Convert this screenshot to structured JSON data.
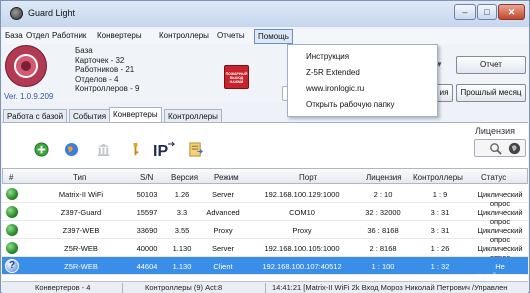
{
  "window": {
    "title": "Guard Light",
    "minimize": "–",
    "maximize": "□",
    "close": "✕"
  },
  "menu": [
    "База",
    "Отдел",
    "Работник",
    "Конвертеры",
    "Контроллеры",
    "Отчеты",
    "Помощь"
  ],
  "info": {
    "db_label": "База",
    "cards": "Карточек - 32",
    "workers": "Работников - 21",
    "departments": "Отделов - 4",
    "controllers": "Контроллеров - 9",
    "version": "Ver. 1.0.9.209",
    "partial_o": "От",
    "partial_c": "С",
    "emergency_lines": [
      "ПОЖАРНЫЙ",
      "ВЫХОД",
      "НАЖМИ"
    ]
  },
  "buttons": {
    "report": "Отчет",
    "prev_month": "Прошлый месяц",
    "partial_ya": "ия"
  },
  "help_menu": {
    "items": [
      "Инструкция",
      "Z-5R Extended",
      "www.ironlogic.ru",
      "Открыть рабочую папку"
    ]
  },
  "tabs": [
    "Работа с базой",
    "События",
    "Конвертеры",
    "Контроллеры"
  ],
  "toolbar": {
    "icons": [
      "add-icon",
      "globe-icon",
      "bank-icon",
      "key-icon",
      "ip-icon",
      "document-icon"
    ],
    "license_label": "Лицензия"
  },
  "table": {
    "headers": [
      "#",
      "Тип",
      "S/N",
      "Версия",
      "Режим",
      "Порт",
      "Лицензия",
      "Контроллеры",
      "Статус"
    ],
    "rows": [
      {
        "type": "Matrix-II WiFi",
        "sn": "50103",
        "version": "1.26",
        "mode": "Server",
        "port": "192.168.100.129:1000",
        "license": "2 : 10",
        "controllers": "1 : 9",
        "status": "Циклический опрос"
      },
      {
        "type": "Z397-Guard",
        "sn": "15597",
        "version": "3.3",
        "mode": "Advanced",
        "port": "COM10",
        "license": "32 : 32000",
        "controllers": "3 : 31",
        "status": "Циклический опрос"
      },
      {
        "type": "Z397-WEB",
        "sn": "33690",
        "version": "3.55",
        "mode": "Proxy",
        "port": "Proxy",
        "license": "36 : 8168",
        "controllers": "3 : 31",
        "status": "Циклический опрос"
      },
      {
        "type": "Z5R-WEB",
        "sn": "40000",
        "version": "1.130",
        "mode": "Server",
        "port": "192.168.100.105:1000",
        "license": "2 : 8168",
        "controllers": "1 : 26",
        "status": "Циклический опрос"
      },
      {
        "type": "Z5R-WEB",
        "sn": "44604",
        "version": "1.130",
        "mode": "Client",
        "port": "192.168.100.107:40512",
        "license": "1 : 100",
        "controllers": "1 : 32",
        "status": "Не задействован",
        "selected": true
      }
    ]
  },
  "statusbar": {
    "converters": "Конвертеров - 4",
    "controllers": "Контроллеры (9) Act:8",
    "event": "14:41:21 [Matrix-II WiFi 2k Вход Мороз Николай Петрович /Управлен"
  }
}
